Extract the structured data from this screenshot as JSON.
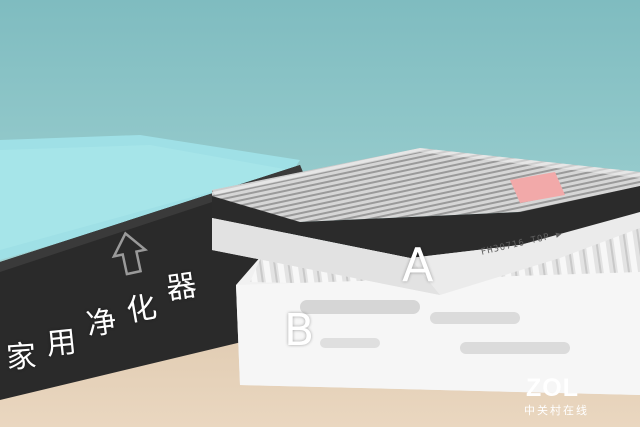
{
  "filter_a_label": "A",
  "filter_b_label": "B",
  "caption_chars": [
    "家",
    "用",
    "净",
    "化",
    "器"
  ],
  "filter_a_print": "FH30716 TOP ▶",
  "watermark": {
    "logo": "ZOL",
    "subtitle": "中关村在线"
  },
  "colors": {
    "background_top": "#86c0c4",
    "table": "#e2cdb4",
    "foam": "#2b2b2b",
    "frame_white": "#f1f1f1"
  }
}
